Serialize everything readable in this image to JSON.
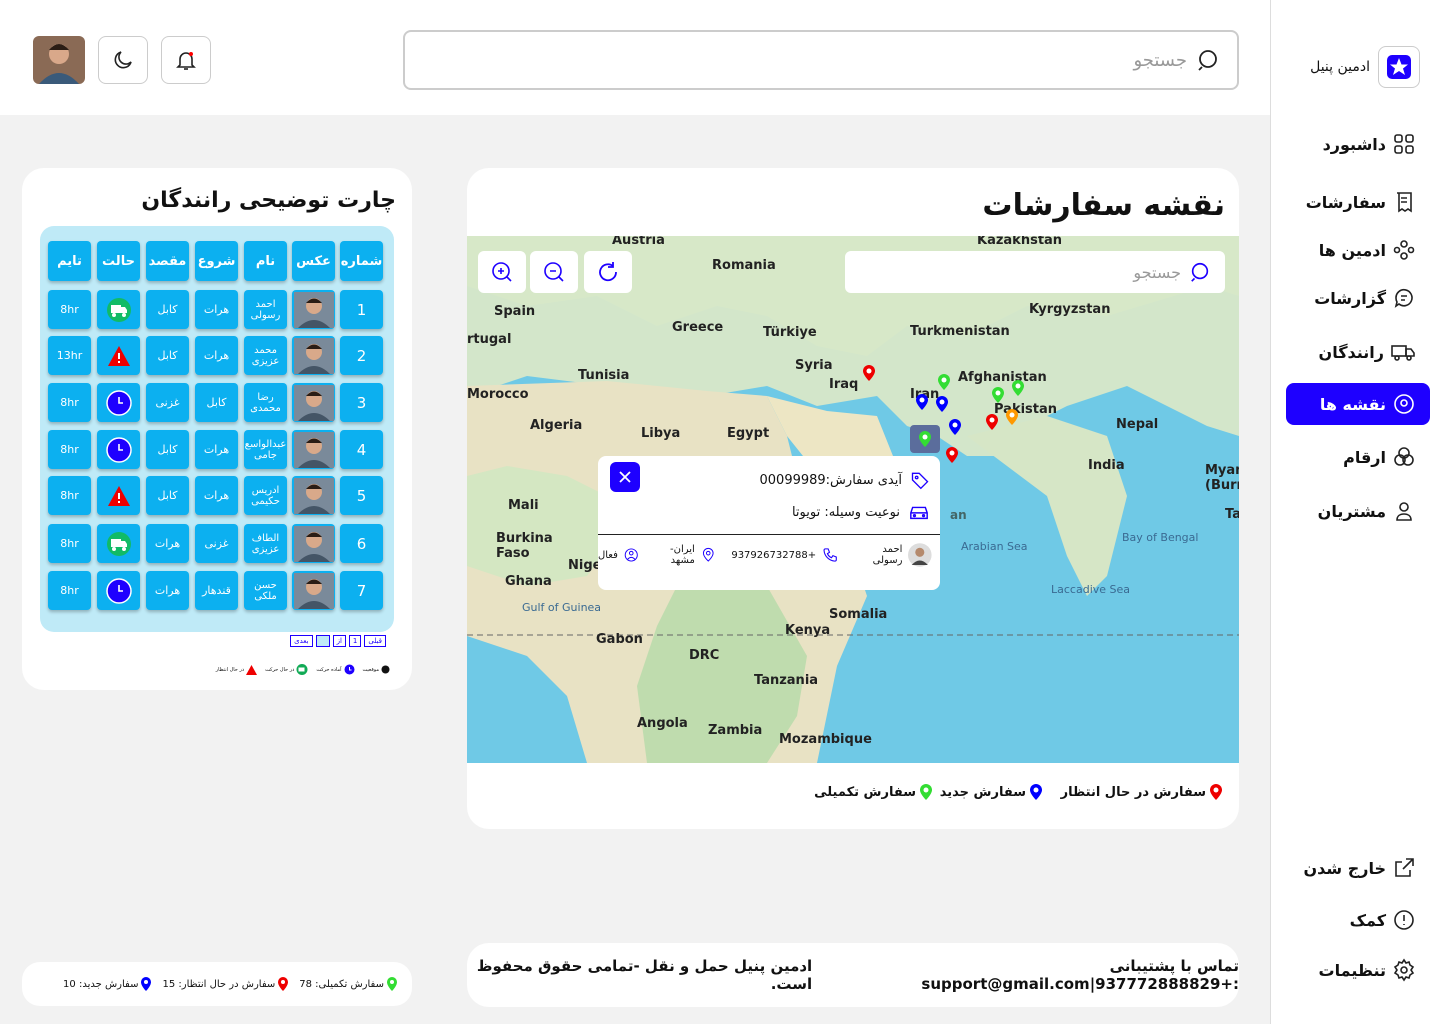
{
  "brand": {
    "name": "ادمین پنیل"
  },
  "nav": [
    {
      "label": "داشبورد",
      "icon": "dashboard-icon"
    },
    {
      "label": "سفارشات",
      "icon": "orders-icon"
    },
    {
      "label": "ادمین ها",
      "icon": "admins-icon"
    },
    {
      "label": "گزارشات",
      "icon": "reports-icon"
    },
    {
      "label": "رانندگان",
      "icon": "truck-icon"
    },
    {
      "label": "نقشه ها",
      "icon": "map-pin-icon"
    },
    {
      "label": "ارقام",
      "icon": "stats-icon"
    },
    {
      "label": "مشتریان",
      "icon": "user-icon"
    }
  ],
  "nav_bottom": [
    {
      "label": "خارج شدن",
      "icon": "logout-icon"
    },
    {
      "label": "کمک",
      "icon": "help-icon"
    },
    {
      "label": "تنظیمات",
      "icon": "settings-icon"
    }
  ],
  "search": {
    "placeholder": "جستجو"
  },
  "map": {
    "title": "نقشه سفارشات",
    "search_placeholder": "جستجو",
    "labels": {
      "austria": "Austria",
      "kazakhstan": "Kazakhstan",
      "romania": "Romania",
      "kyrgyzstan": "Kyrgyzstan",
      "spain": "Spain",
      "greece": "Greece",
      "turkiye": "Türkiye",
      "turkmenistan": "Turkmenistan",
      "tugal": "rtugal",
      "tunisia": "Tunisia",
      "syria": "Syria",
      "iraq": "Iraq",
      "afghanistan": "Afghanistan",
      "iran": "Iran",
      "pakistan": "Pakistan",
      "morocco": "Morocco",
      "algeria": "Algeria",
      "libya": "Libya",
      "egypt": "Egypt",
      "nepal": "Nepal",
      "india": "India",
      "myanmar": "Myanm (Burm",
      "mali": "Mali",
      "burkina": "Burkina Faso",
      "ghana": "Ghana",
      "niger": "Nige",
      "arabian_sea": "Arabian Sea",
      "bay_of_bengal": "Bay of Bengal",
      "laccadive": "Laccadive Sea",
      "gulf_guinea": "Gulf of Guinea",
      "somalia": "Somalia",
      "kenya": "Kenya",
      "gabon": "Gabon",
      "drc": "DRC",
      "tanzania": "Tanzania",
      "angola": "Angola",
      "zambia": "Zambia",
      "mozambique": "Mozambique",
      "oman": "an",
      "tl": "Ta"
    },
    "popup": {
      "order_id": "آیدی سفارش:00099989",
      "vehicle": "نوعیت وسیله: تویوتا",
      "driver": "احمد رسولی",
      "phone": "+937926732788",
      "location": "ایران-مشهد",
      "status": "فعال"
    },
    "legend": [
      "سفارش در حال انتظار",
      "سفارش جدید",
      "سفارش تکمیلی"
    ]
  },
  "chart": {
    "title": "چارت توضیحی رانندگان",
    "headers": [
      "شماره",
      "عکس",
      "نام",
      "شروع",
      "مقصد",
      "حالت",
      "تایم"
    ],
    "rows": [
      {
        "n": "1",
        "name": "احمد رسولی",
        "start": "هرات",
        "dest": "کابل",
        "state": "moving",
        "time": "8hr"
      },
      {
        "n": "2",
        "name": "محمد عزیزی",
        "start": "هرات",
        "dest": "کابل",
        "state": "alert",
        "time": "13hr"
      },
      {
        "n": "3",
        "name": "رضا محمدی",
        "start": "کابل",
        "dest": "غزنی",
        "state": "waiting",
        "time": "8hr"
      },
      {
        "n": "4",
        "name": "عبدالواسع جامی",
        "start": "هرات",
        "dest": "کابل",
        "state": "waiting",
        "time": "8hr"
      },
      {
        "n": "5",
        "name": "ادریس حکیمی",
        "start": "هرات",
        "dest": "کابل",
        "state": "alert",
        "time": "8hr"
      },
      {
        "n": "6",
        "name": "الطاف عزیزی",
        "start": "غزنی",
        "dest": "هرات",
        "state": "moving",
        "time": "8hr"
      },
      {
        "n": "7",
        "name": "حسن ملکی",
        "start": "قندهار",
        "dest": "هرات",
        "state": "waiting",
        "time": "8hr"
      }
    ],
    "pager": [
      "قبلی",
      "1",
      "از",
      "",
      "بعدی"
    ],
    "legend": [
      "موقعیت",
      "آماده حرکت",
      "در حال حرکت",
      "در حال انتظار"
    ]
  },
  "footer": {
    "text": "تماس با پشتیبانی :+937772888829|support@gmail.com",
    "rights": "ادمین پنیل حمل و نقل -تمامی حقوق محفوظ است."
  },
  "stats": {
    "completed": "سفارش تکمیلی: 78",
    "pending": "سفارش در حال انتظار:  15",
    "new": "سفارش جدید:  10"
  },
  "colors": {
    "accent": "#1e00ff",
    "cell": "#0cb0f0",
    "pending": "#ff0000",
    "new": "#0000ff",
    "completed": "#33dd33"
  }
}
